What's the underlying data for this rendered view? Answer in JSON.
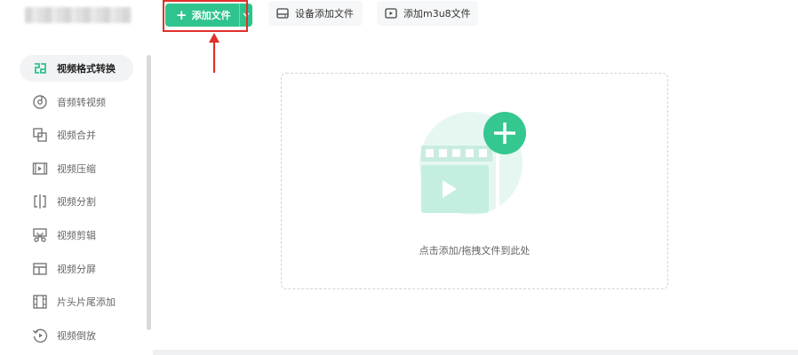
{
  "sidebar": {
    "items": [
      {
        "label": "视频格式转换",
        "icon": "format-convert-icon",
        "active": true
      },
      {
        "label": "音频转视频",
        "icon": "audio-disc-icon",
        "active": false
      },
      {
        "label": "视频合并",
        "icon": "merge-icon",
        "active": false
      },
      {
        "label": "视频压缩",
        "icon": "compress-icon",
        "active": false
      },
      {
        "label": "视频分割",
        "icon": "split-icon",
        "active": false
      },
      {
        "label": "视频剪辑",
        "icon": "scissors-icon",
        "active": false
      },
      {
        "label": "视频分屏",
        "icon": "split-screen-icon",
        "active": false
      },
      {
        "label": "片头片尾添加",
        "icon": "film-strip-icon",
        "active": false
      },
      {
        "label": "视频倒放",
        "icon": "rewind-icon",
        "active": false
      }
    ]
  },
  "toolbar": {
    "add_file_label": "添加文件",
    "add_from_device_label": "设备添加文件",
    "add_m3u8_label": "添加m3u8文件"
  },
  "drop_zone": {
    "hint": "点击添加/拖拽文件到此处"
  },
  "colors": {
    "accent": "#2fc38e",
    "highlight": "#e0302a",
    "illustration_light": "#e6f7f1",
    "illustration_mid": "#c4efe0"
  }
}
